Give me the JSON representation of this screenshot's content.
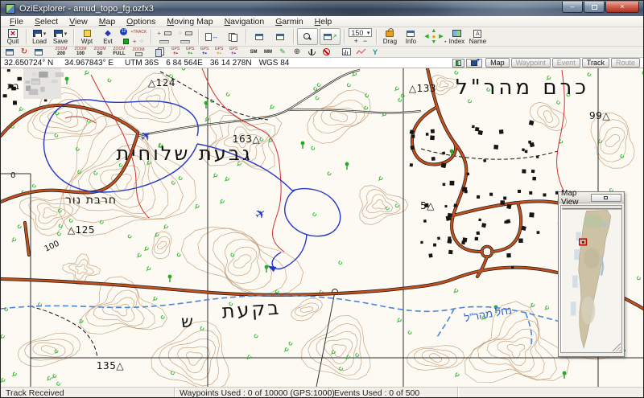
{
  "window": {
    "title": "OziExplorer - amud_topo_fg.ozfx3"
  },
  "menu": {
    "items": [
      "File",
      "Select",
      "View",
      "Map",
      "Options",
      "Moving Map",
      "Navigation",
      "Garmin",
      "Help"
    ]
  },
  "toolbar": {
    "quit": "Quit",
    "load": "Load",
    "save": "Save",
    "wpt": "Wpt",
    "evt": "Evt",
    "track_label": "+TRACK",
    "zoom_level": "150",
    "drag": "Drag",
    "info": "Info",
    "index": "Index",
    "name": "Name",
    "zoom_word": "ZOOM",
    "zoom_presets": [
      "200",
      "100",
      "50",
      "FULL"
    ],
    "gps_word": "GPS",
    "sm_label": "SM",
    "mm_label": "MM"
  },
  "coordbar": {
    "lat": "32.650724° N",
    "lon": "34.967843° E",
    "utm": "UTM 36S",
    "easting": "6 84 564E",
    "northing": "36 14 278N",
    "datum": "WGS 84",
    "buttons": [
      {
        "label": "Map"
      },
      {
        "label": "Waypoint"
      },
      {
        "label": "Event"
      },
      {
        "label": "Track"
      },
      {
        "label": "Route"
      }
    ]
  },
  "map_labels": {
    "spot_124": "△124",
    "spot_133": "△133",
    "spot_163": "163△",
    "spot_99": "99△",
    "spot_125": "△125",
    "spot_5": "5△",
    "spot_135": "135△",
    "contour_100": "100",
    "grid_0": "0",
    "town": "בת",
    "givat": "גבעת שלוחית",
    "kerem": "כרם מהר\"ל",
    "khirbet": "חרבת נור",
    "bikat": "בקעת",
    "shin": "ש",
    "nahal": "נחל מהר\"ל"
  },
  "map_view": {
    "title": "Map View"
  },
  "statusbar": {
    "track": "Track Received",
    "waypoints": "Waypoints Used : 0 of 10000   (GPS:1000)",
    "events": "Events Used : 0 of 500"
  }
}
